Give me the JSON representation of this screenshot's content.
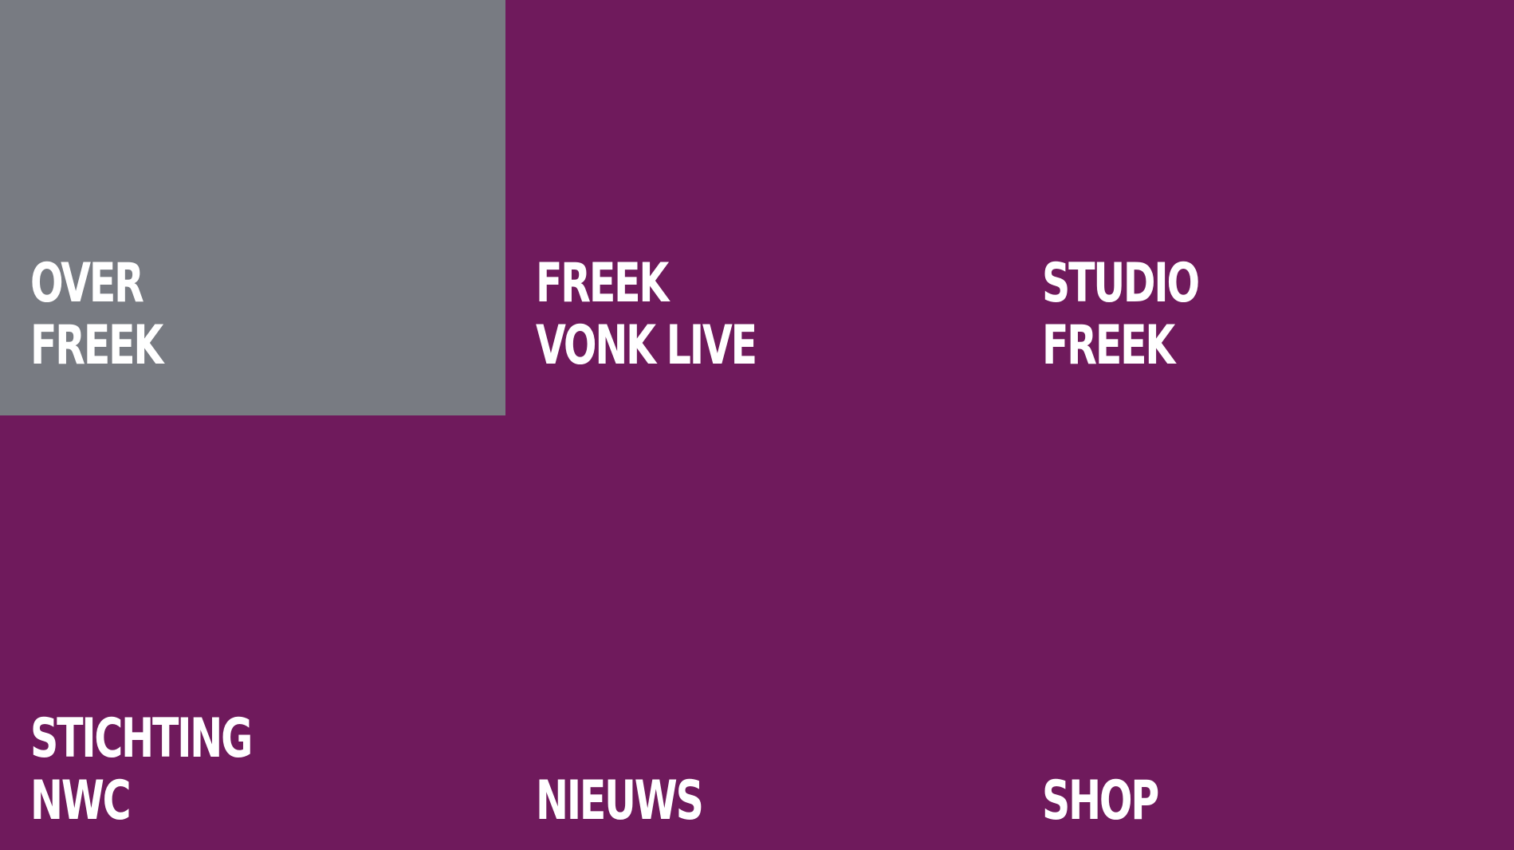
{
  "colors": {
    "tile_default": "#6f1a5c",
    "tile_active": "#787b82",
    "text": "#ffffff"
  },
  "menu": {
    "items": [
      {
        "line1": "OVER",
        "line2": "FREEK",
        "active": true
      },
      {
        "line1": "FREEK",
        "line2": "VONK LIVE",
        "active": false
      },
      {
        "line1": "STUDIO",
        "line2": "FREEK",
        "active": false
      },
      {
        "line1": "STICHTING",
        "line2": "NWC",
        "active": false
      },
      {
        "line1": "",
        "line2": "NIEUWS",
        "active": false
      },
      {
        "line1": "",
        "line2": "SHOP",
        "active": false
      }
    ]
  }
}
